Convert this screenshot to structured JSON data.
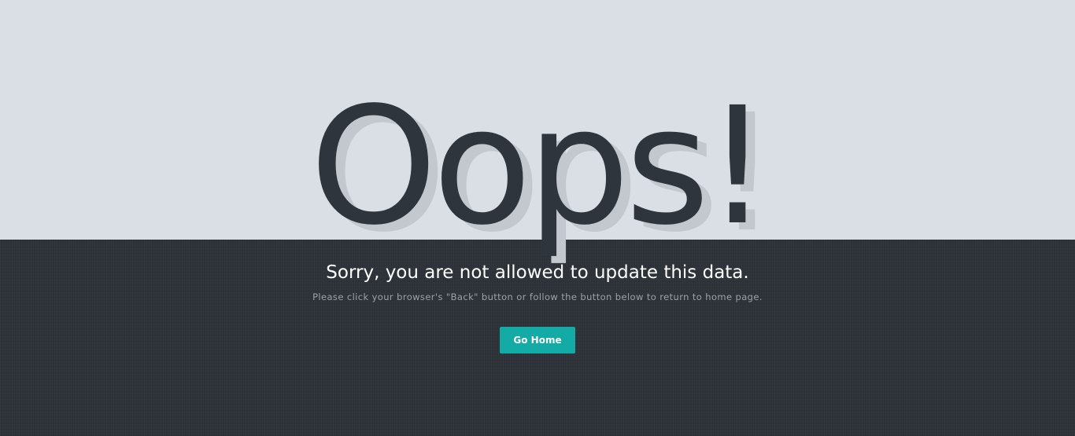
{
  "hero": {
    "title": "Oops!"
  },
  "error": {
    "message": "Sorry, you are not allowed to update this data.",
    "hint": "Please click your browser's \"Back\" button or follow the button below to return to home page."
  },
  "actions": {
    "go_home_label": "Go Home"
  },
  "colors": {
    "top_background": "#dadfe6",
    "bottom_background": "#2d3339",
    "accent": "#14aaa6",
    "headline": "#2e353c"
  }
}
